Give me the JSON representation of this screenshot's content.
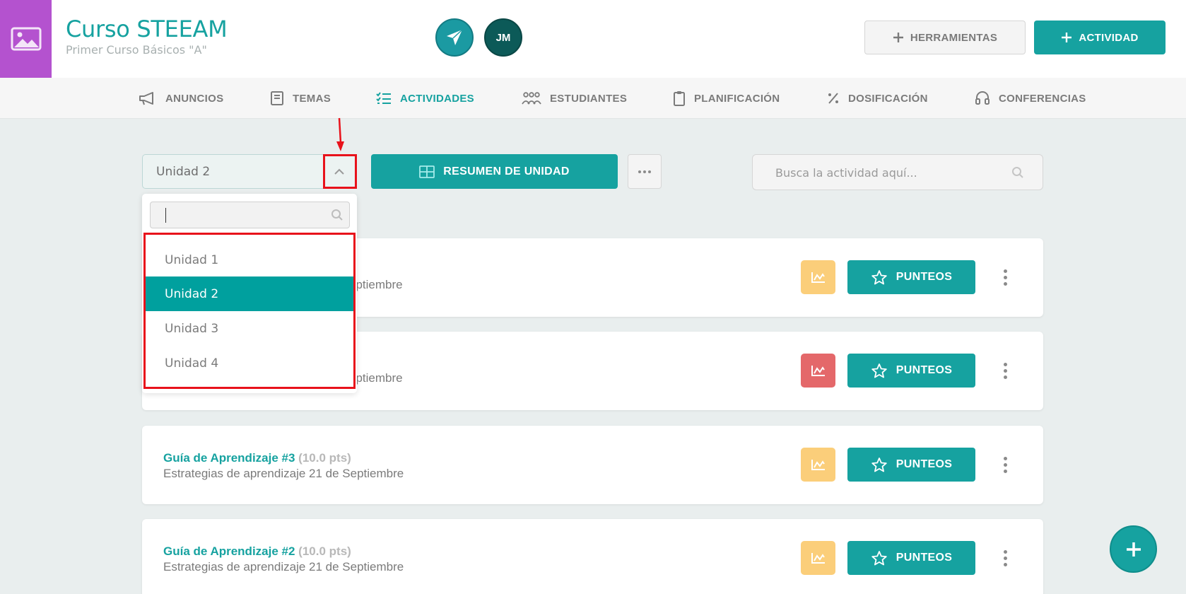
{
  "header": {
    "course_title": "Curso STEEAM",
    "course_subtitle": "Primer Curso Básicos \"A\"",
    "avatar_initials": "JM",
    "tools_label": "HERRAMIENTAS",
    "activity_label": "ACTIVIDAD"
  },
  "nav": {
    "items": [
      {
        "label": "ANUNCIOS",
        "icon": "megaphone-icon"
      },
      {
        "label": "TEMAS",
        "icon": "book-icon"
      },
      {
        "label": "ACTIVIDADES",
        "icon": "checklist-icon",
        "active": true
      },
      {
        "label": "ESTUDIANTES",
        "icon": "students-icon"
      },
      {
        "label": "PLANIFICACIÓN",
        "icon": "clipboard-icon"
      },
      {
        "label": "DOSIFICACIÓN",
        "icon": "percent-icon"
      },
      {
        "label": "CONFERENCIAS",
        "icon": "headset-icon"
      }
    ]
  },
  "toolbar": {
    "unit_selected": "Unidad 2",
    "summary_label": "RESUMEN DE UNIDAD",
    "search_placeholder": "Busca la actividad aquí..."
  },
  "dropdown": {
    "search_value": "",
    "options": [
      "Unidad 1",
      "Unidad 2",
      "Unidad 3",
      "Unidad 4"
    ],
    "selected": "Unidad 2"
  },
  "cards": [
    {
      "title": "",
      "pts": "",
      "desc_visible": "eptiembre",
      "chart_color": "yellow",
      "grades_label": "PUNTEOS"
    },
    {
      "title": "",
      "pts": "",
      "desc_visible": "eptiembre",
      "chart_color": "red",
      "grades_label": "PUNTEOS"
    },
    {
      "title": "Guía de Aprendizaje #3",
      "pts": "(10.0 pts)",
      "desc": "Estrategias de aprendizaje 21 de Septiembre",
      "chart_color": "yellow",
      "grades_label": "PUNTEOS"
    },
    {
      "title": "Guía de Aprendizaje #2",
      "pts": "(10.0 pts)",
      "desc": "Estrategias de aprendizaje 21 de Septiembre",
      "chart_color": "yellow",
      "grades_label": "PUNTEOS"
    }
  ],
  "colors": {
    "accent": "#16a2a0",
    "course_thumb": "#b452cf",
    "highlight_red": "#e8121b",
    "chart_yellow": "#fbce7a",
    "chart_red": "#e4686a"
  }
}
